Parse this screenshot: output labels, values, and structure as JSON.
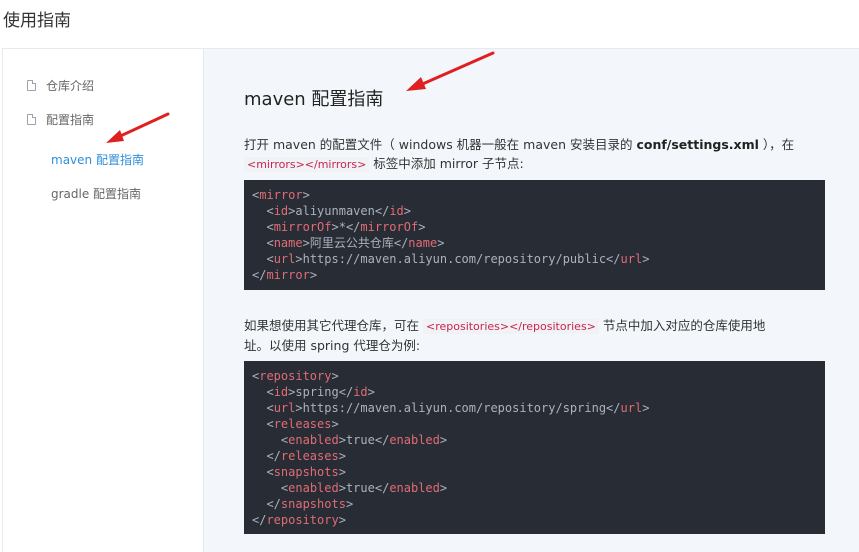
{
  "page": {
    "title": "使用指南"
  },
  "sidebar": {
    "items": [
      {
        "label": "仓库介绍"
      },
      {
        "label": "配置指南"
      }
    ],
    "sub_items": [
      {
        "label": "maven 配置指南",
        "active": true
      },
      {
        "label": "gradle 配置指南",
        "active": false
      }
    ]
  },
  "content": {
    "heading": "maven 配置指南",
    "para1": {
      "before": "打开 maven 的配置文件（ windows 机器一般在 maven 安装目录的 ",
      "bold": "conf/settings.xml",
      "after": " ），在",
      "code": "<mirrors></mirrors>",
      "tail": " 标签中添加 mirror 子节点:"
    },
    "code1": [
      {
        "indent": "",
        "open": "mirror",
        "text": "",
        "close": ""
      },
      {
        "indent": "  ",
        "open": "id",
        "text": "aliyunmaven",
        "close": "id"
      },
      {
        "indent": "  ",
        "open": "mirrorOf",
        "text": "*",
        "close": "mirrorOf"
      },
      {
        "indent": "  ",
        "open": "name",
        "text": "阿里云公共仓库",
        "close": "name"
      },
      {
        "indent": "  ",
        "open": "url",
        "text": "https://maven.aliyun.com/repository/public",
        "close": "url"
      },
      {
        "indent": "",
        "open": "",
        "text": "",
        "close": "mirror"
      }
    ],
    "para2": {
      "before": "如果想使用其它代理仓库，可在 ",
      "code": "<repositories></repositories>",
      "after": " 节点中加入对应的仓库使用地",
      "line2": "址。以使用 spring 代理仓为例:"
    },
    "code2": [
      {
        "indent": "",
        "open": "repository",
        "text": "",
        "close": ""
      },
      {
        "indent": "  ",
        "open": "id",
        "text": "spring",
        "close": "id"
      },
      {
        "indent": "  ",
        "open": "url",
        "text": "https://maven.aliyun.com/repository/spring",
        "close": "url"
      },
      {
        "indent": "  ",
        "open": "releases",
        "text": "",
        "close": ""
      },
      {
        "indent": "    ",
        "open": "enabled",
        "text": "true",
        "close": "enabled"
      },
      {
        "indent": "  ",
        "open": "",
        "text": "",
        "close": "releases"
      },
      {
        "indent": "  ",
        "open": "snapshots",
        "text": "",
        "close": ""
      },
      {
        "indent": "    ",
        "open": "enabled",
        "text": "true",
        "close": "enabled"
      },
      {
        "indent": "  ",
        "open": "",
        "text": "",
        "close": "snapshots"
      },
      {
        "indent": "",
        "open": "",
        "text": "",
        "close": "repository"
      }
    ]
  },
  "colors": {
    "accent": "#2e8fd8",
    "arrow": "#e02020",
    "code_bg": "#282c34",
    "tag": "#e06c75"
  }
}
